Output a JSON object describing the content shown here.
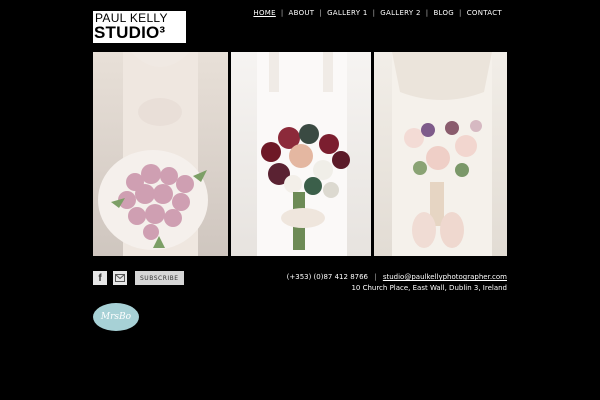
{
  "header": {
    "logo_line1": "PAUL KELLY",
    "logo_line2": "STUDIO³",
    "nav": [
      {
        "label": "HOME"
      },
      {
        "label": "ABOUT"
      },
      {
        "label": "GALLERY 1"
      },
      {
        "label": "GALLERY 2"
      },
      {
        "label": "BLOG"
      },
      {
        "label": "CONTACT"
      }
    ]
  },
  "gallery": {
    "photos": [
      {
        "icon": "wedding-bouquet-pink-roses"
      },
      {
        "icon": "wedding-bouquet-dark-red-mixed"
      },
      {
        "icon": "wedding-bouquet-pale-roses-lace"
      }
    ]
  },
  "footer": {
    "facebook_icon": "f",
    "subscribe_label": "SUBSCRIBE",
    "phone": "(+353) (0)87 412 8766",
    "email": "studio@paulkellyphotographer.com",
    "address": "10 Church Place, East Wall, Dublin 3, Ireland",
    "badge_text": "MrsBo"
  },
  "colors": {
    "background": "#000000",
    "badge": "#a7d1d6"
  }
}
